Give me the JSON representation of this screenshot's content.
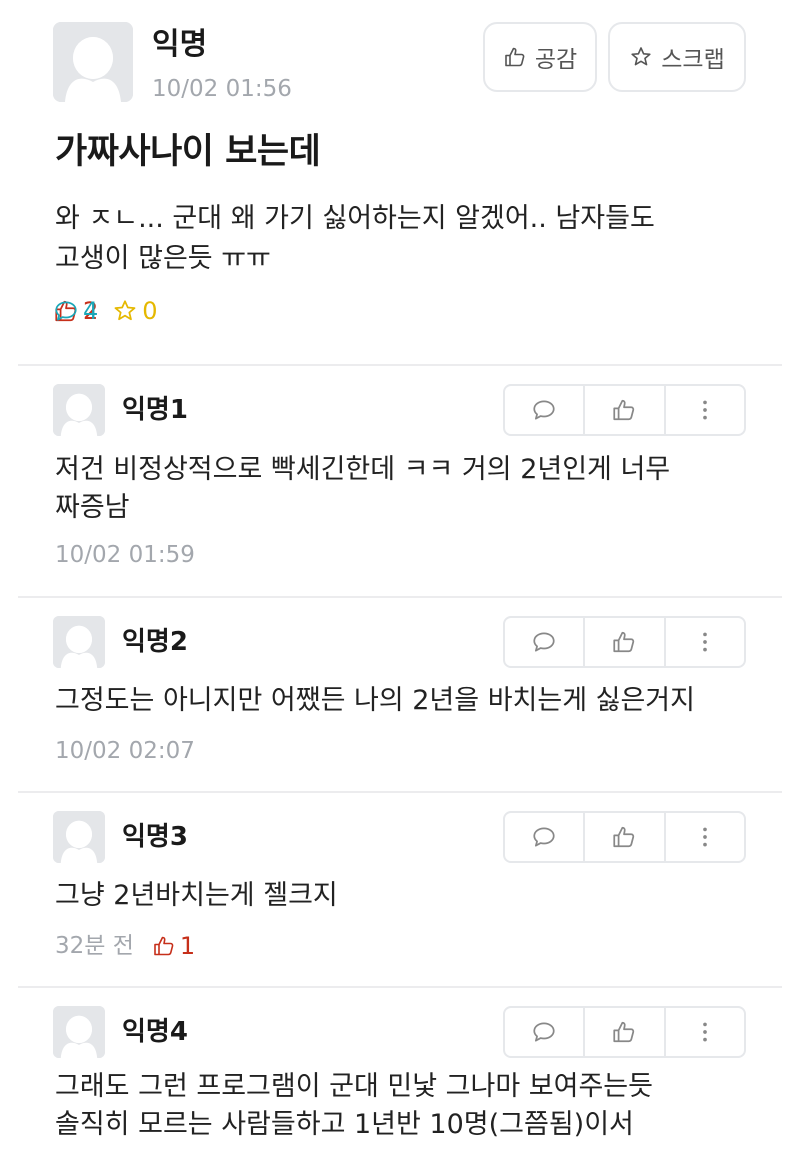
{
  "post": {
    "author": "익명",
    "time": "10/02 01:56",
    "like_button_label": "공감",
    "scrap_button_label": "스크랩",
    "title": "가짜사나이 보는데",
    "body_lines": [
      "와 ㅈㄴ... 군대 왜 가기 싫어하는지 알겠어.. 남자들도",
      "고생이 많은듯 ㅠㅠ"
    ],
    "stats": {
      "likes": "2",
      "comments": "4",
      "scraps": "0"
    }
  },
  "comments": [
    {
      "author": "익명1",
      "lines": [
        "저건 비정상적으로 빡세긴한데 ㅋㅋ 거의 2년인게 너무",
        "짜증남"
      ],
      "time": "10/02 01:59",
      "votes": ""
    },
    {
      "author": "익명2",
      "lines": [
        "그정도는 아니지만 어쨌든 나의 2년을 바치는게 싫은거지"
      ],
      "time": "10/02 02:07",
      "votes": ""
    },
    {
      "author": "익명3",
      "lines": [
        "그냥 2년바치는게 젤크지"
      ],
      "time": "32분 전",
      "votes": "1"
    },
    {
      "author": "익명4",
      "lines": [
        "그래도 그런 프로그램이 군대 민낯 그나마 보여주는듯",
        "솔직히 모르는 사람들하고 1년반 10명(그쯤됨)이서"
      ],
      "time": "",
      "votes": ""
    }
  ],
  "colors": {
    "like": "#c62f1a",
    "comment": "#1aa6b7",
    "scrap": "#e5b800",
    "meta": "#a3a7ad",
    "border": "#e6e8eb"
  },
  "icons": {
    "like": "thumbs-up-icon",
    "comment": "speech-bubble-icon",
    "scrap": "star-icon",
    "more": "more-vertical-icon",
    "avatar": "default-avatar-icon"
  }
}
